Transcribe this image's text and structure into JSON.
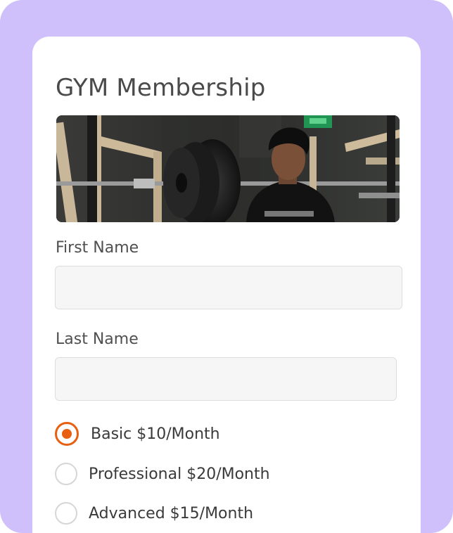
{
  "form": {
    "title": "GYM Membership",
    "hero_image": "gym-photo",
    "first_name": {
      "label": "First Name",
      "value": "",
      "placeholder": ""
    },
    "last_name": {
      "label": "Last Name",
      "value": "",
      "placeholder": ""
    },
    "plans": [
      {
        "label": "Basic $10/Month",
        "selected": true
      },
      {
        "label": "Professional $20/Month",
        "selected": false
      },
      {
        "label": "Advanced $15/Month",
        "selected": false
      }
    ]
  },
  "colors": {
    "background": "#cfc0fb",
    "card": "#ffffff",
    "accent": "#e8600f",
    "input_bg": "#f6f6f6",
    "input_border": "#dedede"
  }
}
